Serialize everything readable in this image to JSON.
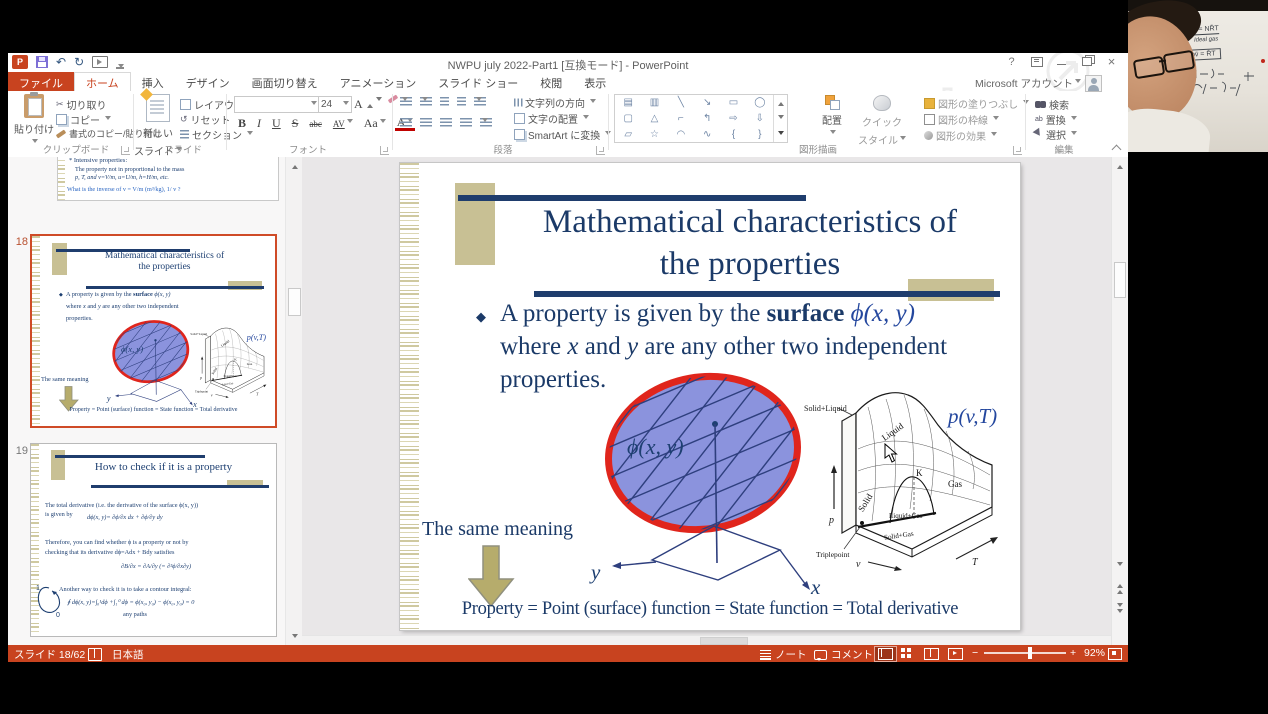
{
  "titlebar": {
    "title": "NWPU july 2022-Part1 [互換モード] - PowerPoint",
    "account": "Microsoft アカウント",
    "help": "?"
  },
  "tabs": {
    "file": "ファイル",
    "home": "ホーム",
    "insert": "挿入",
    "design": "デザイン",
    "transitions": "画面切り替え",
    "animations": "アニメーション",
    "slideshow": "スライド ショー",
    "review": "校閲",
    "view": "表示"
  },
  "ribbon": {
    "paste": "貼り付け",
    "cut": "切り取り",
    "copy": "コピー",
    "format_painter": "書式のコピー/貼り付け",
    "clipboard_label": "クリップボード",
    "new_slide_1": "新しい",
    "new_slide_2": "スライド",
    "layout": "レイアウト",
    "reset": "リセット",
    "section": "セクション",
    "slides_label": "スライド",
    "font_size": "24",
    "bold": "B",
    "italic": "I",
    "underline": "U",
    "strike": "S",
    "strike2": "abc",
    "spacing": "AV",
    "case": "Aa",
    "font_color": "A",
    "grow": "A",
    "shrink": "A",
    "font_label": "フォント",
    "text_direction": "文字列の方向",
    "align_text": "文字の配置",
    "smartart": "SmartArt に変換",
    "paragraph_label": "段落",
    "arrange": "配置",
    "quick_1": "クイック",
    "quick_2": "スタイル",
    "shape_fill": "図形の塗りつぶし",
    "shape_outline": "図形の枠線",
    "shape_effects": "図形の効果",
    "drawing_label": "図形描画",
    "find": "検索",
    "replace": "置換",
    "select": "選択",
    "editing_label": "編集"
  },
  "icons": {
    "cut": "✂",
    "undo": "↶",
    "redo": "↻",
    "reset": "↺",
    "replace_ab": "ab",
    "shapes": [
      "▤",
      "▥",
      "╲",
      "↘",
      "▭",
      "◯",
      "▢",
      "△",
      "⌐",
      "↰",
      "⇨",
      "⇩",
      "▱",
      "☆",
      "◠",
      "∿",
      "{",
      "}"
    ]
  },
  "panel": {
    "t17_l1": "* Intensive properties:",
    "t17_l2": "The property not in proportional to the mass",
    "t17_l3": "p, T, and v=V/m, u=U/m, h=H/m, etc.",
    "t17_l4": "What is the inverse of v = V/m  (m³/kg), 1/ v ?",
    "num18": "18",
    "num19": "19"
  },
  "slide": {
    "title1": "Mathematical characteristics of",
    "title2": "the properties",
    "bullet": "◆",
    "b1a": "A property is given by the ",
    "b1b": "surface",
    "b1c": " ϕ(x, y)",
    "b2a": "where ",
    "b2b": "x",
    "b2c": " and ",
    "b2d": "y",
    "b2e": " are any other two independent",
    "b3": "properties.",
    "phi": "ϕ(x, y)",
    "same_meaning": "The same meaning",
    "bottom": "Property = Point (surface) function = State function = Total derivative",
    "x": "x",
    "y": "y"
  },
  "pvt": {
    "label": "p(v,T)",
    "solid_liquid": "Solid+Liquid",
    "liquid": "Liquid",
    "k": "K",
    "gas": "Gas",
    "liquid_gas": "Liquid+Gas",
    "solid_gas": "Solid+Gas",
    "solid": "Solid",
    "triple": "Triplepoint",
    "p": "p",
    "v": "v",
    "t": "T"
  },
  "t19": {
    "title": "How to check if it is a property",
    "l1": "The total derivative (i.e. the derivative of the surface ϕ(x, y))",
    "l2": "is given by",
    "f1": "dϕ(x, y)= ∂ϕ/∂x dx + ∂ϕ/∂y dy",
    "l3": "Therefore, you can find whether ϕ is a property or not by",
    "l4": "checking that its derivative  dϕ=Adx + Bdy  satisfies",
    "f2": "∂B/∂x = ∂A/∂y (= ∂²ϕ/∂x∂y)",
    "l5": "Another way to check it is to take a contour integral:",
    "f3": "∮ dϕ(x, y)=∫₀¹dϕ +∫₁⁰ dϕ = ϕ(x₀, y₀) − ϕ(x₀, y₀) = 0",
    "f4": "any paths",
    "one": "1",
    "zero": "0"
  },
  "status": {
    "slide_counter": "スライド 18/62",
    "language": "日本語",
    "notes": "ノート",
    "comments": "コメント",
    "zoom_percent": "92%",
    "minus": "−",
    "plus": "+"
  },
  "webcam": {
    "line1": "pV̄ = NR̄T",
    "line2": "Ideal gas",
    "line3": "pv̄ = R̄T"
  }
}
